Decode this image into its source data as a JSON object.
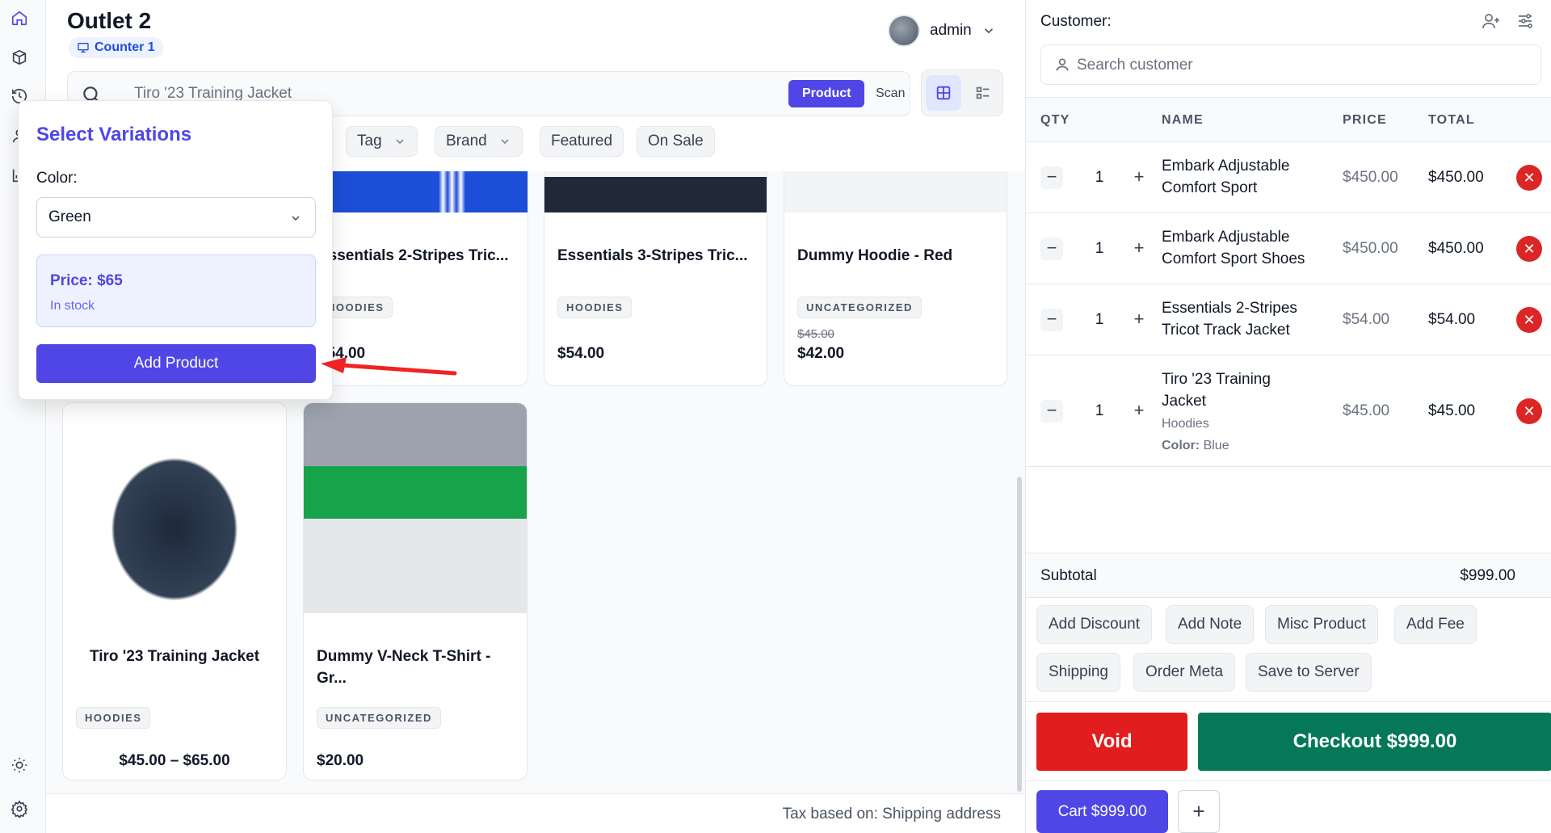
{
  "header": {
    "outlet_name": "Outlet 2",
    "counter_label": "Counter 1",
    "user_name": "admin"
  },
  "search": {
    "value": "Tiro '23 Training Jacket",
    "mode_product": "Product",
    "mode_scan": "Scan"
  },
  "filters": [
    "Tag",
    "Brand",
    "Featured",
    "On Sale"
  ],
  "products": [
    {
      "name": "Essentials 2-Stripes Tric...",
      "category": "HOODIES",
      "price": "$54.00"
    },
    {
      "name": "Essentials 3-Stripes Tric...",
      "category": "HOODIES",
      "price": "$54.00"
    },
    {
      "name": "Dummy Hoodie - Red",
      "category": "UNCATEGORIZED",
      "old_price": "$45.00",
      "price": "$42.00"
    },
    {
      "name": "Tiro '23 Training Jacket",
      "category": "HOODIES",
      "price": "$45.00 – $65.00"
    },
    {
      "name": "Dummy V-Neck T-Shirt - Gr...",
      "category": "UNCATEGORIZED",
      "price": "$20.00"
    }
  ],
  "footer": {
    "tax_note": "Tax based on: Shipping address"
  },
  "variations_popover": {
    "title": "Select Variations",
    "color_label": "Color:",
    "color_value": "Green",
    "price_label": "Price: $65",
    "stock_label": "In stock",
    "add_button": "Add Product"
  },
  "cart": {
    "customer_label": "Customer:",
    "customer_placeholder": "Search customer",
    "columns": {
      "qty": "QTY",
      "name": "NAME",
      "price": "PRICE",
      "total": "TOTAL"
    },
    "items": [
      {
        "qty": "1",
        "name": "Embark Adjustable Comfort Sport",
        "price": "$450.00",
        "total": "$450.00"
      },
      {
        "qty": "1",
        "name": "Embark Adjustable Comfort Sport Shoes",
        "price": "$450.00",
        "total": "$450.00"
      },
      {
        "qty": "1",
        "name": "Essentials 2-Stripes Tricot Track Jacket",
        "price": "$54.00",
        "total": "$54.00"
      },
      {
        "qty": "1",
        "name": "Tiro '23 Training Jacket",
        "category": "Hoodies",
        "attr_label": "Color:",
        "attr_value": "Blue",
        "price": "$45.00",
        "total": "$45.00"
      }
    ],
    "subtotal_label": "Subtotal",
    "subtotal_value": "$999.00",
    "actions": [
      "Add Discount",
      "Add Note",
      "Misc Product",
      "Add Fee",
      "Shipping",
      "Order Meta",
      "Save to Server"
    ],
    "void_label": "Void",
    "checkout_label": "Checkout $999.00",
    "cart_tab_label": "Cart $999.00",
    "add_cart_label": "+"
  },
  "colors": {
    "accent": "#4f46e5",
    "void": "#e11d1d",
    "checkout": "#047857",
    "remove": "#dc2626"
  },
  "icons": [
    "home-icon",
    "box-icon",
    "history-icon",
    "user-icon",
    "chart-icon",
    "sun-icon",
    "settings-icon",
    "search-icon",
    "grid-view-icon",
    "list-view-icon",
    "add-user-icon",
    "sliders-icon",
    "chevron-down-icon"
  ]
}
